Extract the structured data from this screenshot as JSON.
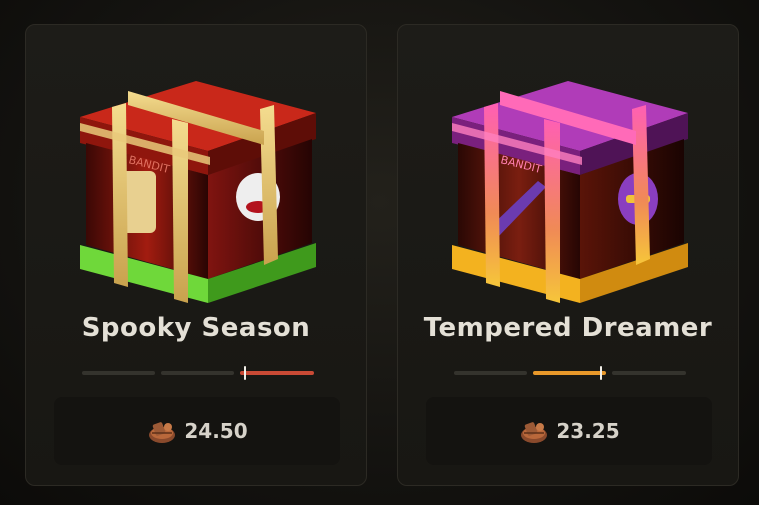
{
  "cases": [
    {
      "name": "Spooky Season",
      "price": "24.50",
      "rarity_color": "#c94a35",
      "crate_top_color": "#c9281a",
      "crate_bottom_color": "#6fd83a",
      "crate_label": "BANDIT",
      "icon": "crate-icon"
    },
    {
      "name": "Tempered Dreamer",
      "price": "23.25",
      "rarity_color": "#e8982a",
      "crate_top_color": "#b03cb8",
      "crate_bottom_color": "#f3b21f",
      "crate_label": "BANDIT",
      "icon": "crate-icon"
    }
  ],
  "currency_icon": "scrap-coin-icon"
}
